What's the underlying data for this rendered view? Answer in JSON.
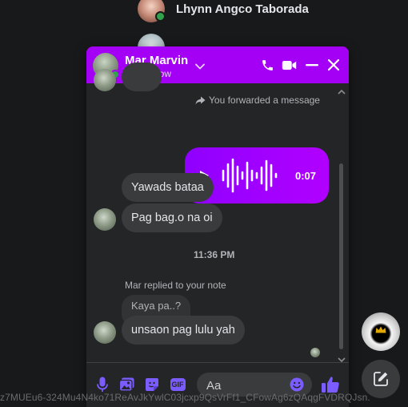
{
  "contacts": [
    {
      "name": "Lhynn Angco Taborada",
      "online": true
    },
    {
      "name": "",
      "online": false
    }
  ],
  "chat": {
    "contact_name": "Mar Marvin",
    "status": "Active now",
    "header_color": "#a400f5",
    "header_icons": [
      "chevron-down-icon",
      "phone-icon",
      "video-icon",
      "minimize-icon",
      "close-icon"
    ]
  },
  "messages": {
    "forwarded_note": "You forwarded a message",
    "voice_duration": "0:07",
    "bubble_1": "Yawads bataa",
    "bubble_2": "Pag bag.o na oi",
    "time_divider": "11:36 PM",
    "reply_note": "Mar replied to your note",
    "quoted_note": "Kaya pa..?",
    "bubble_3": "unsaon pag lulu yah"
  },
  "composer": {
    "placeholder": "Aa",
    "icons": [
      "microphone-icon",
      "image-icon",
      "sticker-icon",
      "gif-icon",
      "emoji-icon",
      "like-icon"
    ],
    "gif_label": "GIF"
  },
  "bottom_url": "z7MUEu6-324Mu4N4ko71ReAvJkYwlC03jcxp9QsVrFf1_CFowAg6zQAqgFVDRQJsn."
}
